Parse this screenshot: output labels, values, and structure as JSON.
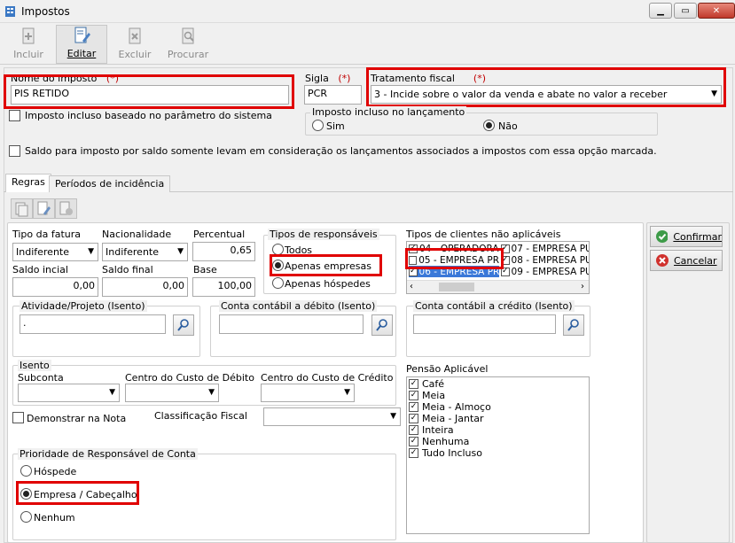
{
  "window": {
    "title": "Impostos"
  },
  "toolbar": {
    "incluir": "Incluir",
    "editar": "Editar",
    "excluir": "Excluir",
    "procurar": "Procurar"
  },
  "header": {
    "nome_label": "Nome do imposto",
    "required_mark": "(*)",
    "nome_value": "PIS RETIDO",
    "sigla_label": "Sigla",
    "sigla_value": "PCR",
    "tratamento_label": "Tratamento fiscal",
    "tratamento_value": "3 - Incide sobre o valor da venda e abate no valor a receber",
    "incluso_param_label": "Imposto incluso baseado no parâmetro do sistema",
    "incluso_lanc_title": "Imposto incluso no lançamento",
    "sim": "Sim",
    "nao": "Não",
    "saldo_label": "Saldo para imposto por saldo somente levam em consideração os lançamentos associados a impostos com essa opção marcada."
  },
  "tabs": [
    "Regras",
    "Períodos de incidência"
  ],
  "regras": {
    "tipo_fatura_label": "Tipo da fatura",
    "tipo_fatura_value": "Indiferente",
    "nacionalidade_label": "Nacionalidade",
    "nacionalidade_value": "Indiferente",
    "percentual_label": "Percentual",
    "percentual_value": "0,65",
    "saldo_inicial_label": "Saldo incial",
    "saldo_inicial_value": "0,00",
    "saldo_final_label": "Saldo final",
    "saldo_final_value": "0,00",
    "base_label": "Base",
    "base_value": "100,00",
    "tipos_resp_title": "Tipos de responsáveis",
    "todos": "Todos",
    "apenas_empresas": "Apenas empresas",
    "apenas_hospedes": "Apenas hóspedes",
    "tipos_clientes_label": "Tipos de clientes não aplicáveis",
    "clientes_col1": [
      {
        "label": "04 - OPERADORA",
        "checked": true
      },
      {
        "label": "05 - EMPRESA PR",
        "checked": false
      },
      {
        "label": "06 - EMPRESA PR",
        "checked": true,
        "selected": true
      }
    ],
    "clientes_col2": [
      {
        "label": "07 - EMPRESA PU",
        "checked": true
      },
      {
        "label": "08 - EMPRESA PU",
        "checked": true
      },
      {
        "label": "09 - EMPRESA PU",
        "checked": true
      }
    ],
    "atividade_label": "Atividade/Projeto  (Isento)",
    "atividade_value": ".",
    "conta_debito_label": "Conta contábil a débito  (Isento)",
    "conta_credito_label": "Conta contábil a crédito  (Isento)",
    "isento_title": "Isento",
    "subconta_label": "Subconta",
    "ccusto_debito_label": "Centro do Custo de Débito",
    "ccusto_credito_label": "Centro do Custo de Crédito",
    "demonstrar_label": "Demonstrar na Nota",
    "classificacao_label": "Classificação Fiscal",
    "pensao_label": "Pensão Aplicável",
    "pensao_items": [
      "Café",
      "Meia",
      "Meia - Almoço",
      "Meia - Jantar",
      "Inteira",
      "Nenhuma",
      "Tudo Incluso"
    ],
    "prioridade_title": "Prioridade de Responsável de Conta",
    "hospede": "Hóspede",
    "empresa_cabecalho": "Empresa / Cabeçalho",
    "nenhum": "Nenhum"
  },
  "buttons": {
    "confirmar": "Confirmar",
    "cancelar": "Cancelar"
  }
}
